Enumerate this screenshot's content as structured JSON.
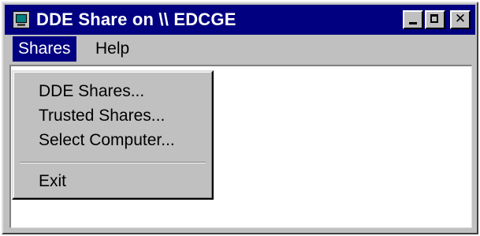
{
  "window": {
    "title": "DDE Share on \\\\ EDCGE"
  },
  "menubar": {
    "items": [
      "Shares",
      "Help"
    ]
  },
  "shares_menu": {
    "items": [
      "DDE Shares...",
      "Trusted Shares...",
      "Select Computer...",
      "Exit"
    ]
  },
  "colors": {
    "titlebar": "#000080",
    "face": "#c0c0c0",
    "client": "#ffffff"
  }
}
